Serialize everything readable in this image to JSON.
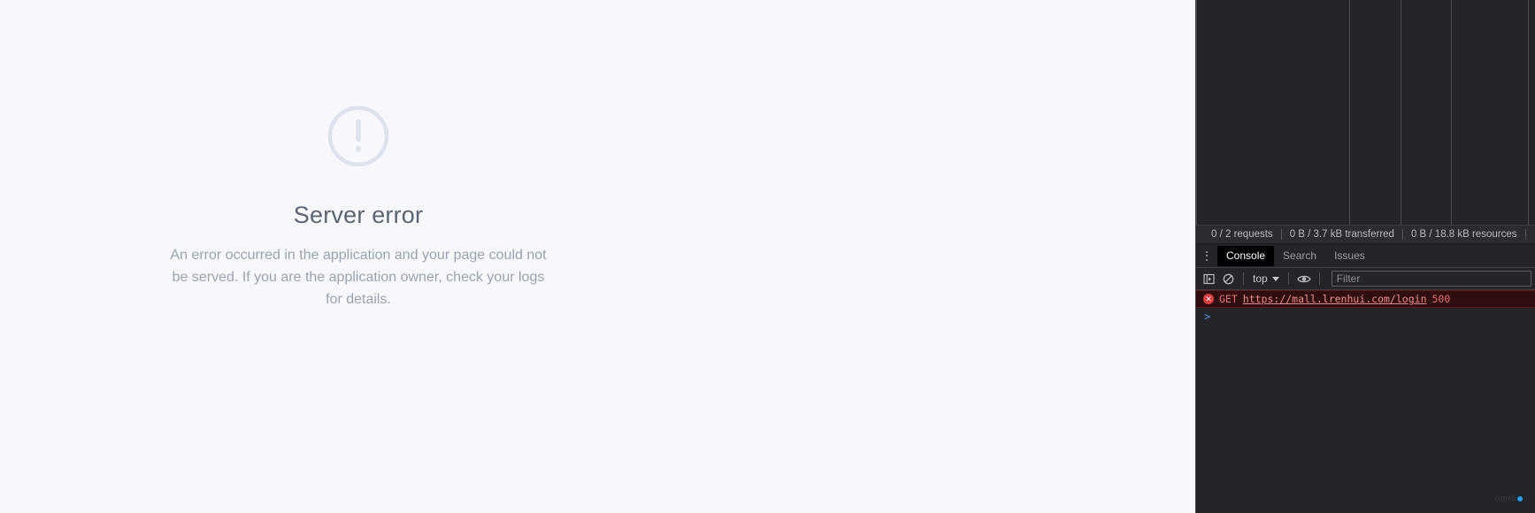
{
  "page": {
    "icon": "exclamation-circle-icon",
    "title": "Server error",
    "description": "An error occurred in the application and your page could not be served. If you are the application owner, check your logs for details.",
    "title_color": "#5b6472",
    "icon_color": "#dde2ec",
    "background": "#f6f8fb"
  },
  "devtools": {
    "network_summary": [
      "0 / 2 requests",
      "0 B / 3.7 kB transferred",
      "0 B / 18.8 kB resources"
    ],
    "kebab_menu": "more-tools-menu",
    "tabs": [
      {
        "label": "Console",
        "active": true
      },
      {
        "label": "Search",
        "active": false
      },
      {
        "label": "Issues",
        "active": false
      }
    ],
    "toolbar": {
      "sidebar_toggle": "console-sidebar-icon",
      "clear_console": "clear-console-icon",
      "context": "top",
      "live_expression": "eye-icon",
      "filter_placeholder": "Filter"
    },
    "console": {
      "messages": [
        {
          "level": "error",
          "badge": "✕",
          "method": "GET",
          "url": "https://mall.lrenhui.com/login",
          "status": "500"
        }
      ],
      "prompt": ">"
    },
    "watermark": "crmeb",
    "accent_error": "#e03b3b",
    "accent_prompt": "#4a90e2"
  }
}
